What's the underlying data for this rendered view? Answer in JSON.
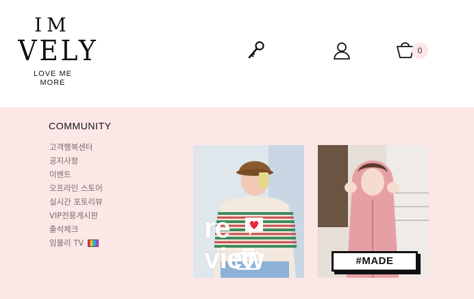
{
  "header": {
    "logo": {
      "line1": "IM",
      "line2": "VELY",
      "tagline1": "LOVE ME",
      "tagline2": "MORE"
    },
    "icons": {
      "login": "key-icon",
      "account": "user-icon",
      "cart": "cart-icon"
    },
    "cart_count": "0"
  },
  "community": {
    "title": "COMMUNITY",
    "items": [
      {
        "label": "고객행복센터"
      },
      {
        "label": "공지사항"
      },
      {
        "label": "이벤트"
      },
      {
        "label": "오프라인 스토어"
      },
      {
        "label": "실시간 포토리뷰"
      },
      {
        "label": "VIP전용게시판"
      },
      {
        "label": "출석체크"
      },
      {
        "label": "임블리 TV"
      }
    ]
  },
  "banners": {
    "review": {
      "word1": "re",
      "word2": "view"
    },
    "made": {
      "label": "#MADE"
    }
  },
  "colors": {
    "page_bg": "#fce6e6",
    "header_bg": "#ffffff",
    "heart": "#e8263c"
  }
}
